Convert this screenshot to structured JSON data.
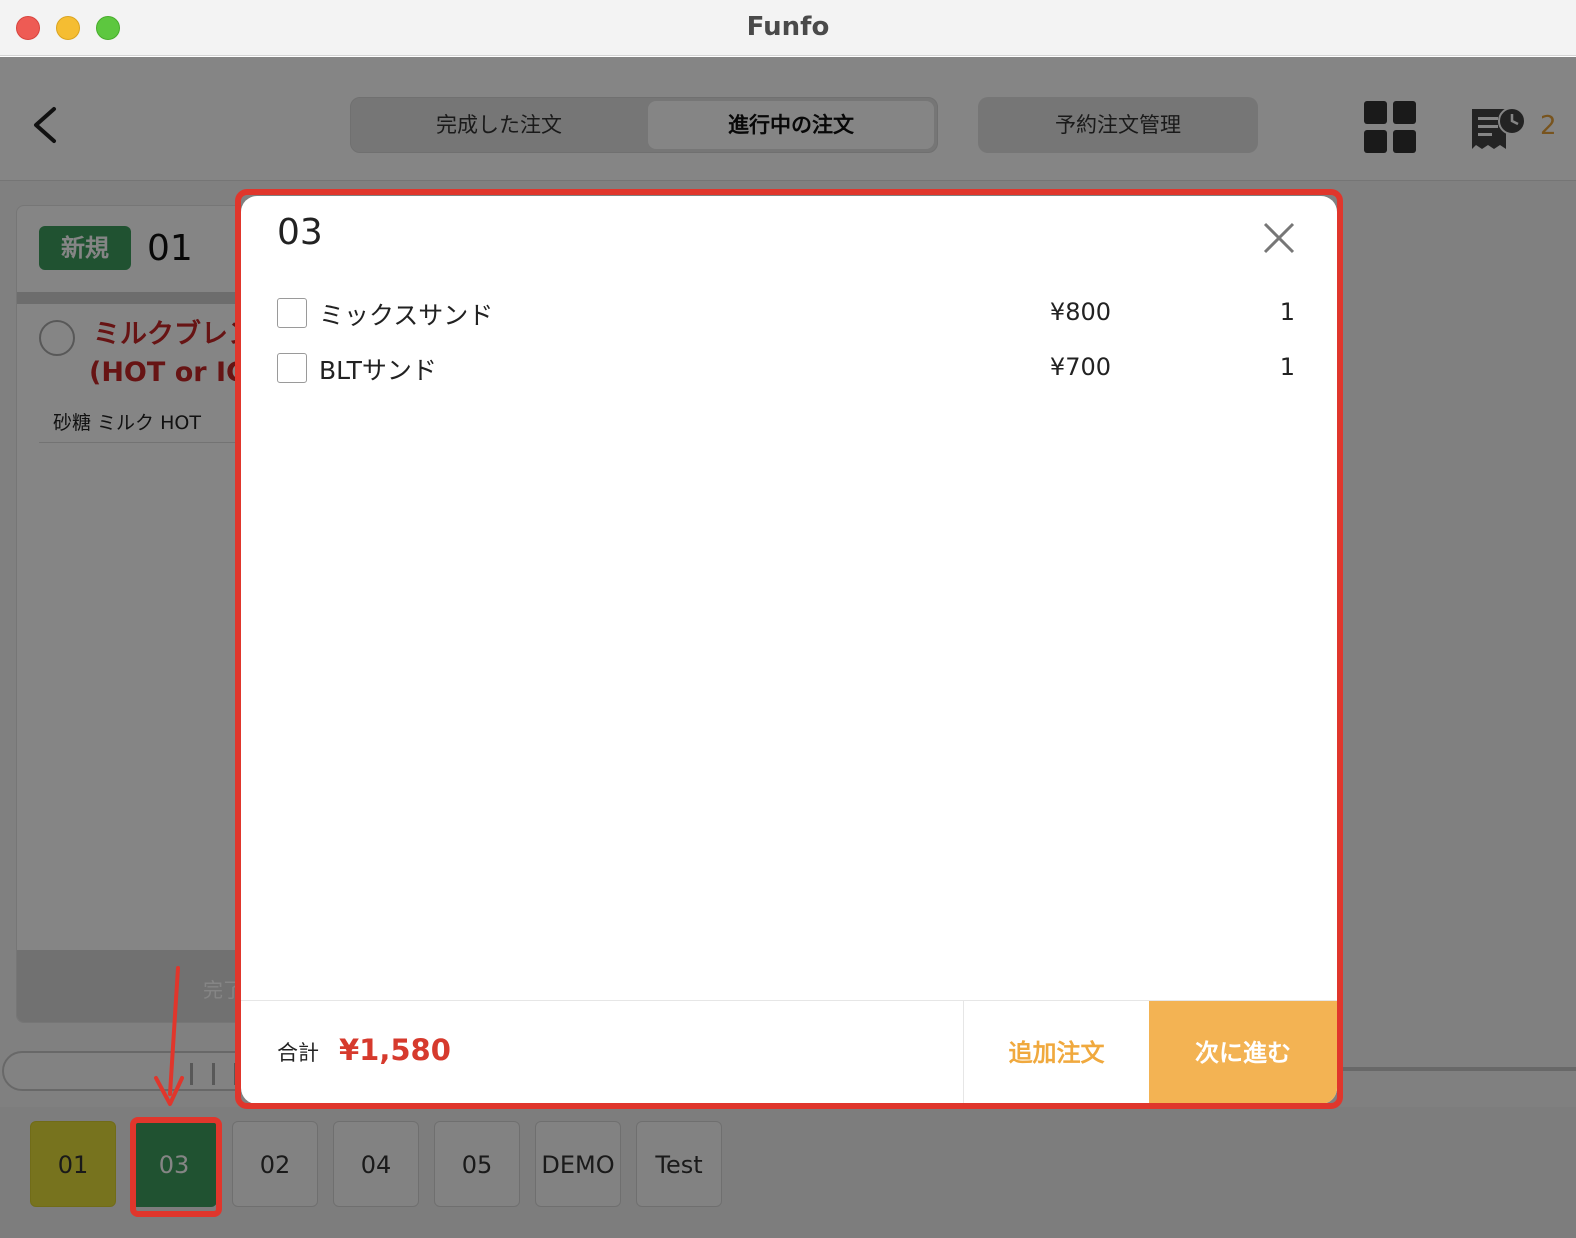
{
  "window": {
    "title": "Funfo"
  },
  "header": {
    "tabs": [
      {
        "label": "完成した注文",
        "active": false
      },
      {
        "label": "進行中の注文",
        "active": true
      }
    ],
    "reserve_label": "予約注文管理",
    "receipt_count": "2"
  },
  "background_order": {
    "badge": "新規",
    "number": "01",
    "item_line1": "ミルクブレン",
    "item_line2": "(HOT or ICE",
    "options": "砂糖 ミルク HOT",
    "footer_label": "完了"
  },
  "modal": {
    "title": "03",
    "items": [
      {
        "name": "ミックスサンド",
        "price": "¥800",
        "qty": "1",
        "checked": false
      },
      {
        "name": "BLTサンド",
        "price": "¥700",
        "qty": "1",
        "checked": false
      }
    ],
    "total_label": "合計",
    "total_value": "¥1,580",
    "add_order_label": "追加注文",
    "next_label": "次に進む"
  },
  "tables": [
    {
      "label": "01",
      "state": "yellow"
    },
    {
      "label": "03",
      "state": "green"
    },
    {
      "label": "02",
      "state": "normal"
    },
    {
      "label": "04",
      "state": "normal"
    },
    {
      "label": "05",
      "state": "normal"
    },
    {
      "label": "DEMO",
      "state": "normal"
    },
    {
      "label": "Test",
      "state": "normal"
    }
  ],
  "colors": {
    "accent_orange": "#f3b353",
    "price_red": "#d63a2d",
    "badge_green": "#3e9e5e",
    "annotation_red": "#e0362c"
  }
}
